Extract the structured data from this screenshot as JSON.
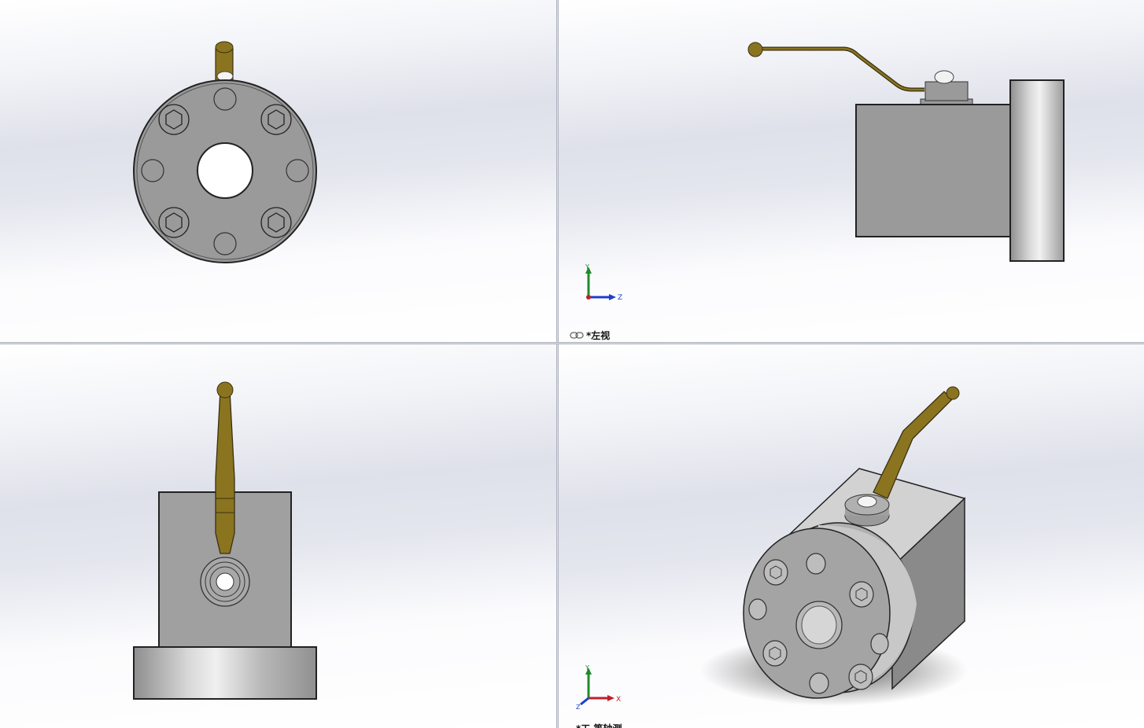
{
  "viewports": {
    "front": {
      "label": ""
    },
    "left": {
      "label": "*左视"
    },
    "top": {
      "label": ""
    },
    "isometric": {
      "label": "*工 等轴测"
    }
  },
  "triad": {
    "y_label": "Y",
    "z_label": "Z",
    "x_label": "X"
  },
  "colors": {
    "background_top": "#ffffff",
    "background_band": "#dfe1ea",
    "part_gray": "#9a9a9a",
    "handle_brass": "#8a7420",
    "axis_x": "#c0202a",
    "axis_y": "#1f8a2a",
    "axis_z": "#1f3fc8"
  },
  "icons": [
    "link-icon",
    "coordinate-triad-icon"
  ]
}
